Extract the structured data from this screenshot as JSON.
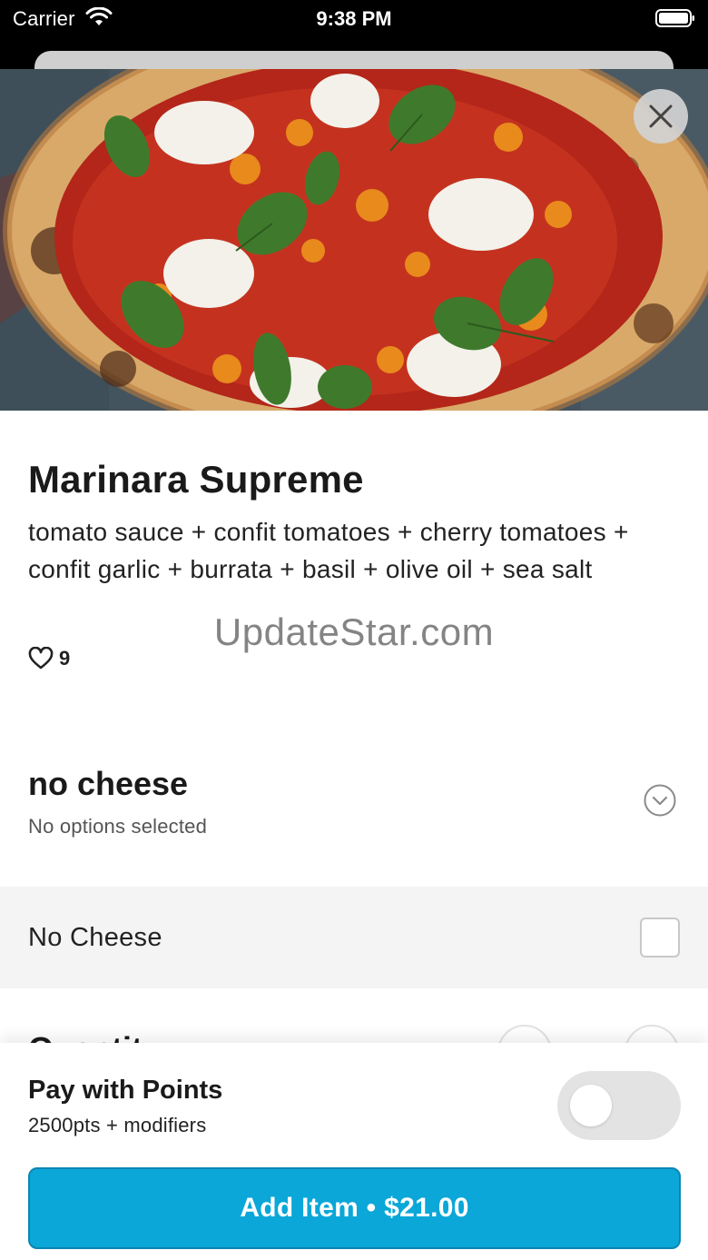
{
  "status_bar": {
    "carrier": "Carrier",
    "time": "9:38 PM"
  },
  "item": {
    "title": "Marinara Supreme",
    "description": "tomato sauce + confit tomatoes + cherry tomatoes + confit garlic + burrata + basil + olive oil + sea salt",
    "likes": "9",
    "image_alt": "Marinara Supreme pizza with burrata, basil and cherry tomatoes"
  },
  "watermark": "UpdateStar.com",
  "modifier_group": {
    "title": "no cheese",
    "subtitle": "No options selected",
    "options": [
      {
        "label": "No Cheese",
        "checked": false
      }
    ]
  },
  "quantity": {
    "label": "Quantity"
  },
  "points": {
    "title": "Pay with Points",
    "subtitle": "2500pts + modifiers",
    "enabled": false
  },
  "add_button": {
    "label": "Add Item • $21.00"
  },
  "colors": {
    "accent": "#0aa7d8",
    "toggle_off": "#e3e3e3",
    "option_row_bg": "#f4f4f4"
  }
}
